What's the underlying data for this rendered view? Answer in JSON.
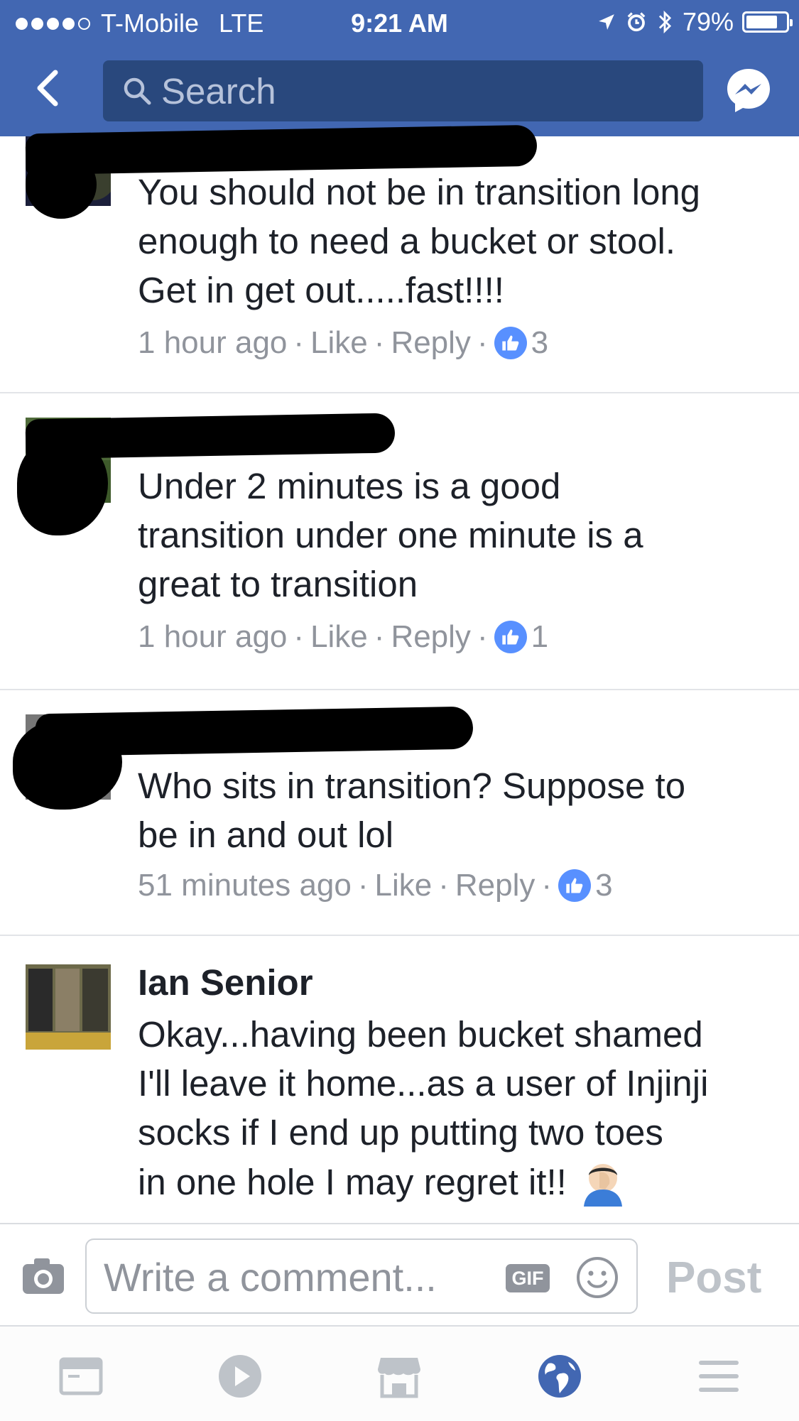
{
  "status_bar": {
    "carrier": "T-Mobile",
    "network": "LTE",
    "time": "9:21 AM",
    "battery": "79%",
    "battery_level": 0.79,
    "icons": [
      "signal-dots-icon",
      "location-arrow-icon",
      "alarm-icon",
      "bluetooth-icon",
      "battery-icon"
    ]
  },
  "nav": {
    "back_icon": "chevron-left-icon",
    "search_placeholder": "Search",
    "messenger_icon": "messenger-icon"
  },
  "colors": {
    "brand_blue": "#4267b2",
    "search_bg": "#29487d",
    "meta_gray": "#90949c",
    "like_blue": "#5890ff"
  },
  "comments": [
    {
      "text_lines": [
        "You should not be in transition long",
        "enough to need a bucket or stool.",
        "Get in get out.....fast!!!!"
      ],
      "time": "1 hour ago",
      "like": "Like",
      "reply": "Reply",
      "reactions": "3"
    },
    {
      "text_lines": [
        "Under 2 minutes is a good",
        "transition under one minute is a",
        "great to transition"
      ],
      "time": "1 hour ago",
      "like": "Like",
      "reply": "Reply",
      "reactions": "1"
    },
    {
      "text_lines": [
        "Who sits in transition? Suppose to",
        "be in and out lol"
      ],
      "time": "51 minutes ago",
      "like": "Like",
      "reply": "Reply",
      "reactions": "3"
    },
    {
      "author": "Ian Senior",
      "text_lines": [
        "Okay...having been bucket shamed",
        "I'll leave it home...as a user of Injinji",
        "socks if I end up putting two toes",
        "in one hole I may regret it!!"
      ],
      "emoji_icon": "face-palm-emoji-icon"
    }
  ],
  "composer": {
    "placeholder": "Write a comment...",
    "gif_label": "GIF",
    "post_label": "Post"
  },
  "tab_bar": {
    "tabs": [
      "news-feed-icon",
      "video-play-icon",
      "marketplace-icon",
      "notifications-globe-icon",
      "menu-icon"
    ],
    "active_tab": "notifications-globe-icon"
  }
}
